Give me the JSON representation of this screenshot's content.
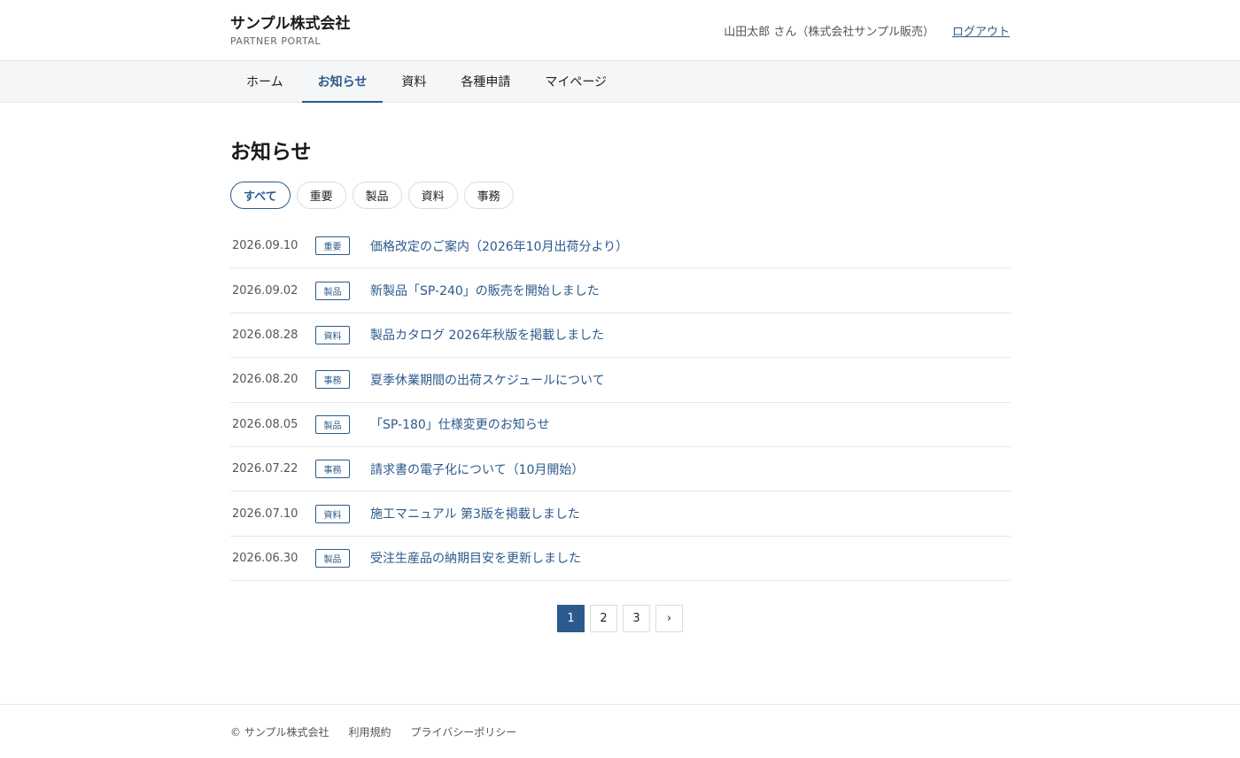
{
  "header": {
    "brand_name": "サンプル株式会社",
    "brand_sub": "PARTNER PORTAL",
    "user_name": "山田太郎 さん（株式会社サンプル販売）",
    "logout": "ログアウト"
  },
  "nav": {
    "items": [
      {
        "label": "ホーム"
      },
      {
        "label": "お知らせ"
      },
      {
        "label": "資料"
      },
      {
        "label": "各種申請"
      },
      {
        "label": "マイページ"
      }
    ],
    "active_index": 1
  },
  "main": {
    "title": "お知らせ",
    "filters": [
      {
        "label": "すべて"
      },
      {
        "label": "重要"
      },
      {
        "label": "製品"
      },
      {
        "label": "資料"
      },
      {
        "label": "事務"
      }
    ],
    "active_filter_index": 0,
    "news": [
      {
        "date": "2026.09.10",
        "tag": "重要",
        "title": "価格改定のご案内（2026年10月出荷分より）"
      },
      {
        "date": "2026.09.02",
        "tag": "製品",
        "title": "新製品「SP-240」の販売を開始しました"
      },
      {
        "date": "2026.08.28",
        "tag": "資料",
        "title": "製品カタログ 2026年秋版を掲載しました"
      },
      {
        "date": "2026.08.20",
        "tag": "事務",
        "title": "夏季休業期間の出荷スケジュールについて"
      },
      {
        "date": "2026.08.05",
        "tag": "製品",
        "title": "「SP-180」仕様変更のお知らせ"
      },
      {
        "date": "2026.07.22",
        "tag": "事務",
        "title": "請求書の電子化について（10月開始）"
      },
      {
        "date": "2026.07.10",
        "tag": "資料",
        "title": "施工マニュアル 第3版を掲載しました"
      },
      {
        "date": "2026.06.30",
        "tag": "製品",
        "title": "受注生産品の納期目安を更新しました"
      }
    ]
  },
  "pagination": {
    "pages": [
      "1",
      "2",
      "3"
    ],
    "current": "1",
    "next": "›"
  },
  "footer": {
    "copyright": "© サンプル株式会社",
    "terms": "利用規約",
    "privacy": "プライバシーポリシー"
  },
  "colors": {
    "accent": "#2c5a8c",
    "nav_bg": "#f5f6f8",
    "border": "#e5e7ea"
  }
}
